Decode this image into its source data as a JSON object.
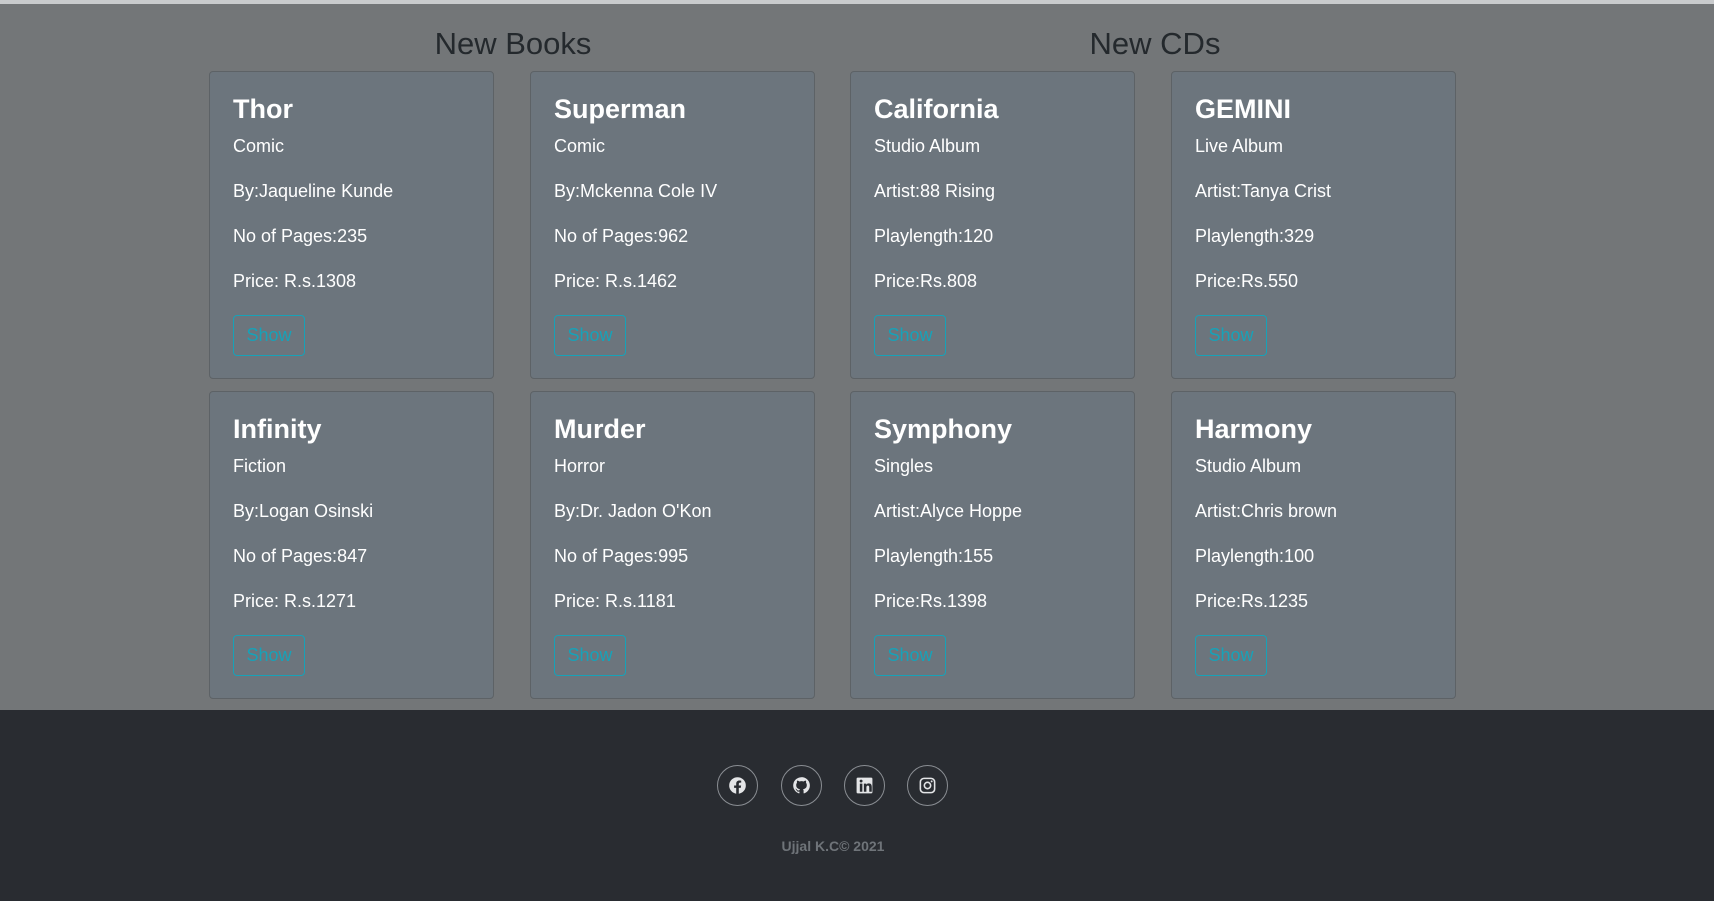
{
  "sections": {
    "books_title": "New Books",
    "cds_title": "New CDs"
  },
  "show_label": "Show",
  "books": [
    {
      "title": "Thor",
      "genre": "Comic",
      "author": "By:Jaqueline Kunde",
      "pages": "No of Pages:235",
      "price": "Price: R.s.1308"
    },
    {
      "title": "Superman",
      "genre": "Comic",
      "author": "By:Mckenna Cole IV",
      "pages": "No of Pages:962",
      "price": "Price: R.s.1462"
    },
    {
      "title": "Infinity",
      "genre": "Fiction",
      "author": "By:Logan Osinski",
      "pages": "No of Pages:847",
      "price": "Price: R.s.1271"
    },
    {
      "title": "Murder",
      "genre": "Horror",
      "author": "By:Dr. Jadon O'Kon",
      "pages": "No of Pages:995",
      "price": "Price: R.s.1181"
    }
  ],
  "cds": [
    {
      "title": "California",
      "type": "Studio Album",
      "artist": "Artist:88 Rising",
      "playlength": "Playlength:120",
      "price": "Price:Rs.808"
    },
    {
      "title": "GEMINI",
      "type": "Live Album",
      "artist": "Artist:Tanya Crist",
      "playlength": "Playlength:329",
      "price": "Price:Rs.550"
    },
    {
      "title": "Symphony",
      "type": "Singles",
      "artist": "Artist:Alyce Hoppe",
      "playlength": "Playlength:155",
      "price": "Price:Rs.1398"
    },
    {
      "title": "Harmony",
      "type": "Studio Album",
      "artist": "Artist:Chris brown",
      "playlength": "Playlength:100",
      "price": "Price:Rs.1235"
    }
  ],
  "footer": {
    "icons": [
      "facebook-icon",
      "github-icon",
      "linkedin-icon",
      "instagram-icon"
    ],
    "copyright": "Ujjal K.C© 2021"
  },
  "colors": {
    "page_background": "#737678",
    "card_background": "#6c757d",
    "button_accent": "#17a2b8",
    "footer_background": "#292c31"
  }
}
